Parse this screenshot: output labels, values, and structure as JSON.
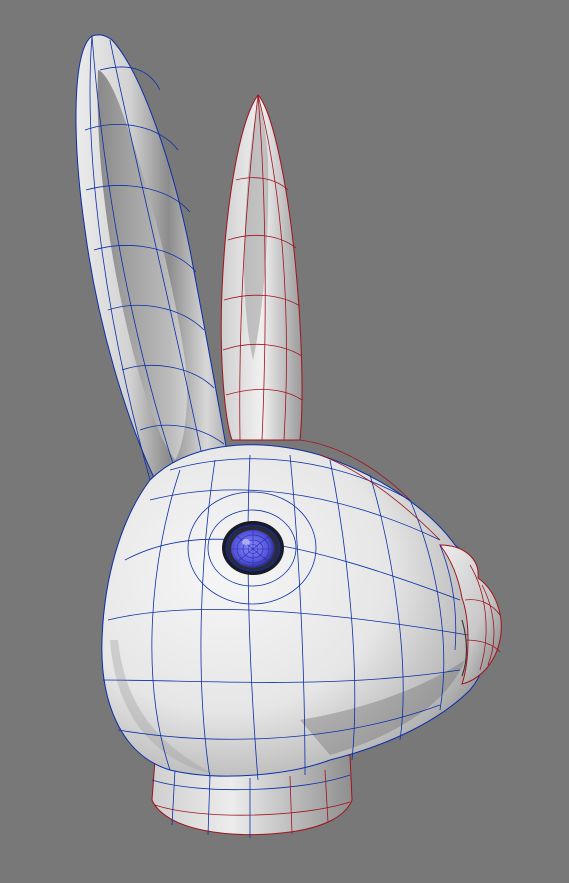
{
  "viewport": {
    "background": "#787878",
    "model": "rabbit-head",
    "shading": "smooth-grey",
    "selected_wire_color": "#0b2fa8",
    "unselected_wire_color": "#a0141e",
    "eye_color": "#5b5de8"
  }
}
